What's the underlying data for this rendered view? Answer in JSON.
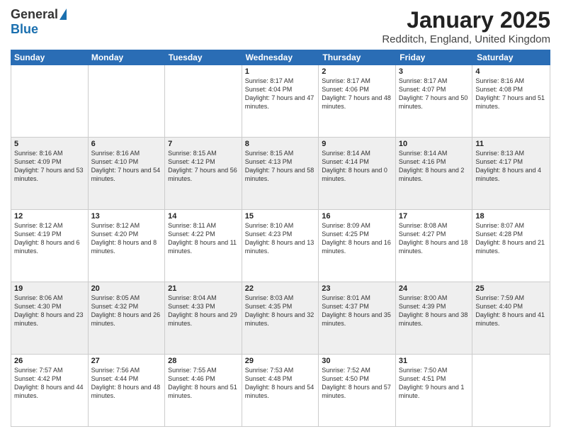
{
  "logo": {
    "general": "General",
    "blue": "Blue"
  },
  "title": {
    "month": "January 2025",
    "location": "Redditch, England, United Kingdom"
  },
  "weekdays": [
    "Sunday",
    "Monday",
    "Tuesday",
    "Wednesday",
    "Thursday",
    "Friday",
    "Saturday"
  ],
  "weeks": [
    [
      {
        "day": "",
        "sunrise": "",
        "sunset": "",
        "daylight": "",
        "empty": true
      },
      {
        "day": "",
        "sunrise": "",
        "sunset": "",
        "daylight": "",
        "empty": true
      },
      {
        "day": "",
        "sunrise": "",
        "sunset": "",
        "daylight": "",
        "empty": true
      },
      {
        "day": "1",
        "sunrise": "Sunrise: 8:17 AM",
        "sunset": "Sunset: 4:04 PM",
        "daylight": "Daylight: 7 hours and 47 minutes."
      },
      {
        "day": "2",
        "sunrise": "Sunrise: 8:17 AM",
        "sunset": "Sunset: 4:06 PM",
        "daylight": "Daylight: 7 hours and 48 minutes."
      },
      {
        "day": "3",
        "sunrise": "Sunrise: 8:17 AM",
        "sunset": "Sunset: 4:07 PM",
        "daylight": "Daylight: 7 hours and 50 minutes."
      },
      {
        "day": "4",
        "sunrise": "Sunrise: 8:16 AM",
        "sunset": "Sunset: 4:08 PM",
        "daylight": "Daylight: 7 hours and 51 minutes."
      }
    ],
    [
      {
        "day": "5",
        "sunrise": "Sunrise: 8:16 AM",
        "sunset": "Sunset: 4:09 PM",
        "daylight": "Daylight: 7 hours and 53 minutes."
      },
      {
        "day": "6",
        "sunrise": "Sunrise: 8:16 AM",
        "sunset": "Sunset: 4:10 PM",
        "daylight": "Daylight: 7 hours and 54 minutes."
      },
      {
        "day": "7",
        "sunrise": "Sunrise: 8:15 AM",
        "sunset": "Sunset: 4:12 PM",
        "daylight": "Daylight: 7 hours and 56 minutes."
      },
      {
        "day": "8",
        "sunrise": "Sunrise: 8:15 AM",
        "sunset": "Sunset: 4:13 PM",
        "daylight": "Daylight: 7 hours and 58 minutes."
      },
      {
        "day": "9",
        "sunrise": "Sunrise: 8:14 AM",
        "sunset": "Sunset: 4:14 PM",
        "daylight": "Daylight: 8 hours and 0 minutes."
      },
      {
        "day": "10",
        "sunrise": "Sunrise: 8:14 AM",
        "sunset": "Sunset: 4:16 PM",
        "daylight": "Daylight: 8 hours and 2 minutes."
      },
      {
        "day": "11",
        "sunrise": "Sunrise: 8:13 AM",
        "sunset": "Sunset: 4:17 PM",
        "daylight": "Daylight: 8 hours and 4 minutes."
      }
    ],
    [
      {
        "day": "12",
        "sunrise": "Sunrise: 8:12 AM",
        "sunset": "Sunset: 4:19 PM",
        "daylight": "Daylight: 8 hours and 6 minutes."
      },
      {
        "day": "13",
        "sunrise": "Sunrise: 8:12 AM",
        "sunset": "Sunset: 4:20 PM",
        "daylight": "Daylight: 8 hours and 8 minutes."
      },
      {
        "day": "14",
        "sunrise": "Sunrise: 8:11 AM",
        "sunset": "Sunset: 4:22 PM",
        "daylight": "Daylight: 8 hours and 11 minutes."
      },
      {
        "day": "15",
        "sunrise": "Sunrise: 8:10 AM",
        "sunset": "Sunset: 4:23 PM",
        "daylight": "Daylight: 8 hours and 13 minutes."
      },
      {
        "day": "16",
        "sunrise": "Sunrise: 8:09 AM",
        "sunset": "Sunset: 4:25 PM",
        "daylight": "Daylight: 8 hours and 16 minutes."
      },
      {
        "day": "17",
        "sunrise": "Sunrise: 8:08 AM",
        "sunset": "Sunset: 4:27 PM",
        "daylight": "Daylight: 8 hours and 18 minutes."
      },
      {
        "day": "18",
        "sunrise": "Sunrise: 8:07 AM",
        "sunset": "Sunset: 4:28 PM",
        "daylight": "Daylight: 8 hours and 21 minutes."
      }
    ],
    [
      {
        "day": "19",
        "sunrise": "Sunrise: 8:06 AM",
        "sunset": "Sunset: 4:30 PM",
        "daylight": "Daylight: 8 hours and 23 minutes."
      },
      {
        "day": "20",
        "sunrise": "Sunrise: 8:05 AM",
        "sunset": "Sunset: 4:32 PM",
        "daylight": "Daylight: 8 hours and 26 minutes."
      },
      {
        "day": "21",
        "sunrise": "Sunrise: 8:04 AM",
        "sunset": "Sunset: 4:33 PM",
        "daylight": "Daylight: 8 hours and 29 minutes."
      },
      {
        "day": "22",
        "sunrise": "Sunrise: 8:03 AM",
        "sunset": "Sunset: 4:35 PM",
        "daylight": "Daylight: 8 hours and 32 minutes."
      },
      {
        "day": "23",
        "sunrise": "Sunrise: 8:01 AM",
        "sunset": "Sunset: 4:37 PM",
        "daylight": "Daylight: 8 hours and 35 minutes."
      },
      {
        "day": "24",
        "sunrise": "Sunrise: 8:00 AM",
        "sunset": "Sunset: 4:39 PM",
        "daylight": "Daylight: 8 hours and 38 minutes."
      },
      {
        "day": "25",
        "sunrise": "Sunrise: 7:59 AM",
        "sunset": "Sunset: 4:40 PM",
        "daylight": "Daylight: 8 hours and 41 minutes."
      }
    ],
    [
      {
        "day": "26",
        "sunrise": "Sunrise: 7:57 AM",
        "sunset": "Sunset: 4:42 PM",
        "daylight": "Daylight: 8 hours and 44 minutes."
      },
      {
        "day": "27",
        "sunrise": "Sunrise: 7:56 AM",
        "sunset": "Sunset: 4:44 PM",
        "daylight": "Daylight: 8 hours and 48 minutes."
      },
      {
        "day": "28",
        "sunrise": "Sunrise: 7:55 AM",
        "sunset": "Sunset: 4:46 PM",
        "daylight": "Daylight: 8 hours and 51 minutes."
      },
      {
        "day": "29",
        "sunrise": "Sunrise: 7:53 AM",
        "sunset": "Sunset: 4:48 PM",
        "daylight": "Daylight: 8 hours and 54 minutes."
      },
      {
        "day": "30",
        "sunrise": "Sunrise: 7:52 AM",
        "sunset": "Sunset: 4:50 PM",
        "daylight": "Daylight: 8 hours and 57 minutes."
      },
      {
        "day": "31",
        "sunrise": "Sunrise: 7:50 AM",
        "sunset": "Sunset: 4:51 PM",
        "daylight": "Daylight: 9 hours and 1 minute."
      },
      {
        "day": "",
        "sunrise": "",
        "sunset": "",
        "daylight": "",
        "empty": true
      }
    ]
  ]
}
